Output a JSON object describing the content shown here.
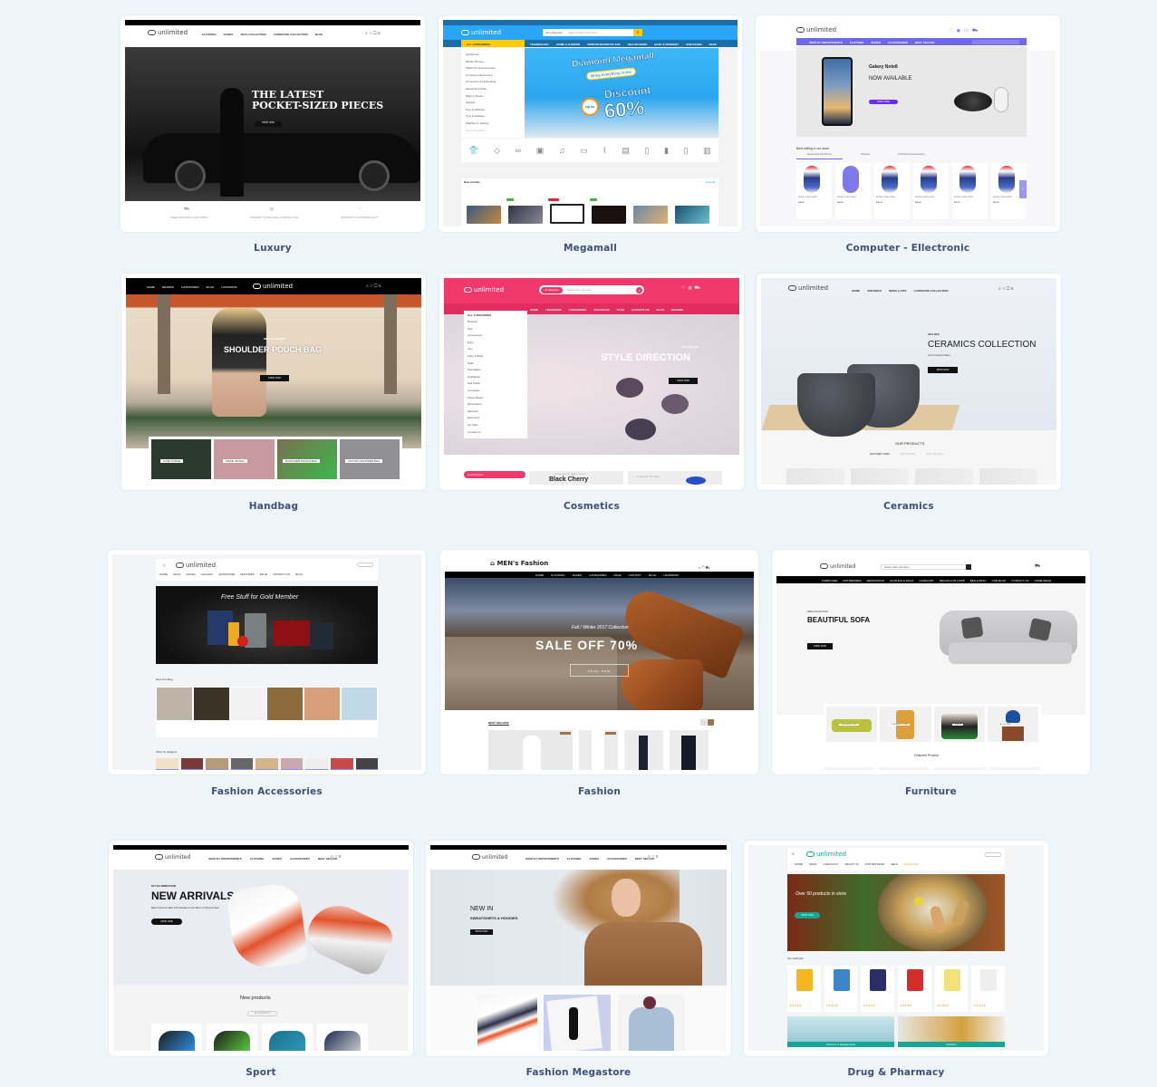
{
  "demos": [
    {
      "label": "Luxury",
      "shot": {
        "logo": "unlimited",
        "nav": [
          "CLOTHING",
          "SHOES",
          "TECH COLLECTION",
          "LOOKBOOK COLLECTION",
          "BLOG"
        ],
        "hero_title_1": "THE LATEST",
        "hero_title_2": "POCKET-SIZED PIECES",
        "hero_button": "SHOP NOW",
        "features": [
          "FREE SHIPPING & RETURNS",
          "PAYMENT IS SECURE & PROTECTED",
          "SUPPORT CUSTOMERS 24/7"
        ]
      }
    },
    {
      "label": "Megamall",
      "shot": {
        "logo": "unlimited",
        "search_category": "All Categories",
        "search_placeholder": "Search entire store here...",
        "all_categories": "ALL CATEGORIES",
        "nav": [
          "TECHNOLOGY",
          "HOME & GARDEN",
          "VENDOR MARKETPLACE",
          "SELLER DEMO",
          "BABY & NURSERY",
          "SUB PAGES",
          "PAGE"
        ],
        "side_categories": [
          "Appliances",
          "Mobile Phones",
          "Tablet PC & Accessories",
          "Consumer Electronics",
          "Computers & Networking",
          "Electrical & Tools",
          "Bags & Shoes",
          "Apparel",
          "Toys & Hobbies",
          "Toys & Hobbies",
          "Watches & Jewelry",
          "Home & Garden"
        ],
        "banner_title": "Diamond Megamall",
        "banner_sub": "Bring everything home",
        "banner_discount": "Discount",
        "banner_up_to": "up to",
        "banner_percent": "60%",
        "section_title": "New arrivals",
        "view_all": "View all"
      }
    },
    {
      "label": "Computer - Ellectronic",
      "shot": {
        "logo": "unlimited",
        "nav": [
          "SHOP BY DEPARTMENTS",
          "CLOTHING",
          "SHOES",
          "ACCESSORIES",
          "BEST SELLING"
        ],
        "search_placeholder": "Search for products...",
        "hero_brand": "Galaxy Note8",
        "hero_title": "NOW AVAILABLE",
        "hero_button": "SHOP NOW",
        "section_title": "Best selling in our store",
        "tabs": [
          "Accessories and Phones",
          "Deskhop",
          "Cell Phones & Accessories"
        ],
        "product_name": "MOUSE LOGITECH M325",
        "product_price": "$36.00"
      }
    },
    {
      "label": "Handbag",
      "shot": {
        "logo": "unlimited",
        "nav": [
          "HOME",
          "BRANDS",
          "CATEGORIES",
          "BLOG",
          "LOOKBOOK"
        ],
        "hero_kicker": "NEW COLLECTION",
        "hero_title": "SHOULDER POUCH BAG",
        "hero_button": "SHOP NOW",
        "tiles": [
          "CASE PURSE",
          "MAKE UP BAG",
          "SHOULDER POUCH BAG",
          "COTTON SHOPPER BAG"
        ]
      }
    },
    {
      "label": "Cosmetics",
      "shot": {
        "logo": "unlimited",
        "search_category": "All Categories",
        "search_placeholder": "Search entire store here...",
        "all_categories": "ALL CATEGORIES",
        "nav": [
          "HOME",
          "LOOKBOOK",
          "CATEGORIES",
          "SUB PAGES",
          "PAGE",
          "CONTACT US",
          "BLOG",
          "BRANDS"
        ],
        "side_categories": [
          "Brushes",
          "Hair",
          "Accessories",
          "Eyes",
          "Lips",
          "Face & Body",
          "Nails",
          "Foundation",
          "Highlighter",
          "Nail Polish",
          "Concealer",
          "Sheet Masks",
          "Eyeshadow",
          "Mascara",
          "Eyebrows",
          "Lip Stain",
          "Contact us"
        ],
        "hero_kicker": "NEW ARRIVALS",
        "hero_title": "STYLE DIRECTION",
        "hero_button": "SHOP NOW",
        "hot_products": "Hot Products",
        "promo_kicker": "Limited Edition",
        "promo_title": "Black Cherry",
        "promo2_kicker": "Lowest Prices"
      }
    },
    {
      "label": "Ceramics",
      "shot": {
        "logo": "unlimited",
        "nav": [
          "HOME",
          "CERAMICS",
          "NEWS & TIPS",
          "LOOKBOOK COLLECTION"
        ],
        "hero_kicker": "20% OFF",
        "hero_title": "CERAMICS COLLECTION",
        "hero_sub": "Lorem ipsum dolor",
        "hero_button": "SHOP NOW",
        "section_title": "OUR PRODUCTS",
        "tabs": [
          "FEATURED ITEMS",
          "NEW ARRIVAL",
          "BEST SELLERS"
        ]
      }
    },
    {
      "label": "Fashion Accessories",
      "shot": {
        "logo": "unlimited",
        "nav": [
          "HOME",
          "SHOP",
          "PAGES",
          "GALLERY",
          "SHOWCASE",
          "FEATURES",
          "PAGE",
          "CONTACT US",
          "BLOG"
        ],
        "banner_title": "Free Stuff for Gold Member",
        "section_title": "New Trending",
        "section2_title": "Shop by category"
      }
    },
    {
      "label": "Fashion",
      "shot": {
        "logo": "MEN's Fashion",
        "nav": [
          "HOME",
          "CLOTHING",
          "SHOES",
          "CATEGORIES",
          "PAGE",
          "CONTACT",
          "BLOG",
          "LOOKBOOK"
        ],
        "hero_kicker": "Fall / Winter 2017 Collection",
        "hero_title": "SALE OFF 70%",
        "hero_button": "shop now",
        "section_title": "BEST SELLERS",
        "sale_badge": "SALE"
      }
    },
    {
      "label": "Furniture",
      "shot": {
        "logo": "unlimited",
        "search_placeholder": "Search entire store here...",
        "nav": [
          "FURNITURE",
          "MATTRESSES",
          "RENOVATION",
          "LIGHTING & RUGS",
          "CATEGORY",
          "DECOR & PILLOWS",
          "BED & BATH",
          "OUR BLOG",
          "CONTACT US",
          "HOME IDEAS"
        ],
        "hero_kicker": "NEW COLLECTION",
        "hero_title": "BEAUTIFUL SOFA",
        "hero_button": "SHOP NOW",
        "tiles": [
          "Contemporary Sofas",
          "Contemporary Chairs",
          "Cushions",
          "Accent Tables"
        ],
        "section_title": "Featured Product"
      }
    },
    {
      "label": "Sport",
      "shot": {
        "logo": "unlimited",
        "nav": [
          "SHOP BY DEPARTMENTS",
          "CLOTHING",
          "SHOES",
          "ACCESSORIES",
          "BEST SELLING"
        ],
        "hero_kicker": "STYLE DIRECTION",
        "hero_title": "NEW ARRIVALS",
        "hero_sub": "Nike's New Air Max 270 Sneaker Is the Best of Old and New",
        "hero_button": "SHOP NOW",
        "section_title": "New products",
        "section_button": "ALL PRODUCTS"
      }
    },
    {
      "label": "Fashion Megastore",
      "shot": {
        "logo": "unlimited",
        "nav": [
          "SHOP BY DEPARTMENTS",
          "CLOTHING",
          "SHOES",
          "ACCESSORIES",
          "BEST SELLING"
        ],
        "hero_title": "NEW IN",
        "hero_sub": "SWEATSHIRTS & HOODIES",
        "hero_button": "SHOP NOW"
      }
    },
    {
      "label": "Drug & Pharmacy",
      "shot": {
        "logo": "unlimited",
        "nav": [
          "HOME",
          "SHOP",
          "CHECKOUT",
          "ABOUT US",
          "FOR RETAILER",
          "HELP",
          "BLOGGING"
        ],
        "hero_title": "Over 50 products in store",
        "hero_button": "SHOP NOW",
        "section_title": "Our staff pick",
        "banners": [
          "Vitamins & Supplements",
          "Nutrition"
        ]
      }
    }
  ],
  "colors": {
    "page_bg": "#eef5f9",
    "label": "#3d4f7a",
    "megamall_blue": "#2aa4f4",
    "megamall_yellow": "#ffcc00",
    "cosmetics_pink": "#f0386b",
    "electronic_purple": "#6f68e8",
    "pharmacy_teal": "#17a596"
  }
}
